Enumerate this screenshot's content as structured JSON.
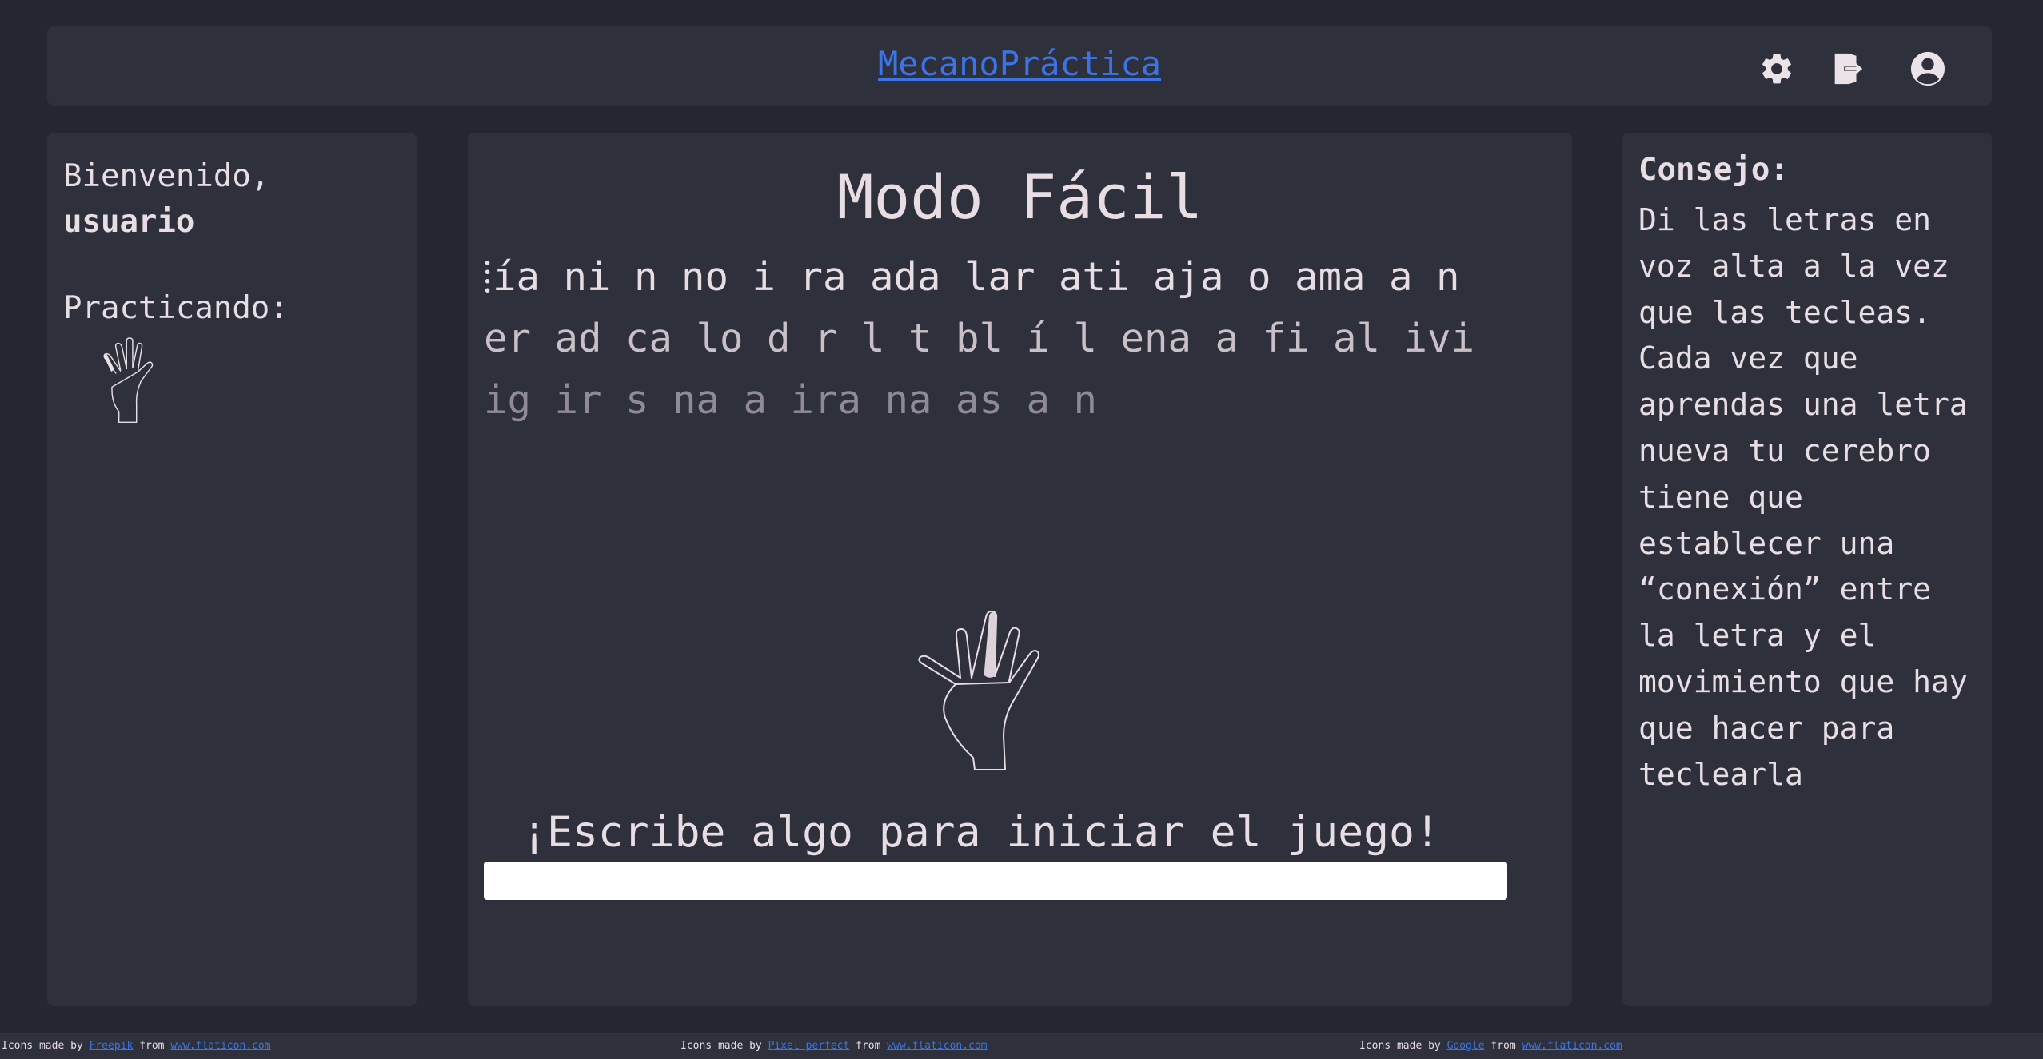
{
  "header": {
    "title": "MecanoPráctica",
    "icons": [
      "gear-icon",
      "logout-icon",
      "user-circle-icon"
    ]
  },
  "sidebar": {
    "greeting": "Bienvenido,",
    "username": "usuario",
    "practicing_label": "Practicando:",
    "practicing_finger": "left-pinky"
  },
  "main": {
    "mode_title": "Modo Fácil",
    "lines": [
      "ía ni n no i ra ada lar ati aja o ama a n",
      "er ad ca lo d r l t bl í l ena a fi al ivi",
      "ig ir s na a ira na as a n"
    ],
    "active_finger": "left-middle",
    "prompt": "¡Escribe algo para iniciar el juego!",
    "input_value": "",
    "input_placeholder": ""
  },
  "tip": {
    "title": "Consejo:",
    "body": "Di las letras en voz alta a la vez que las tecleas. Cada vez que aprendas una letra nueva tu cerebro tiene que establecer una “conexión” entre la letra y el movimiento que hay que hacer para teclearla"
  },
  "footer": {
    "credits": [
      {
        "prefix": "Icons made by",
        "author": "Freepik",
        "mid": "from",
        "site": "www.flaticon.com"
      },
      {
        "prefix": "Icons made by",
        "author": "Pixel perfect",
        "mid": "from",
        "site": "www.flaticon.com"
      },
      {
        "prefix": "Icons made by",
        "author": "Google",
        "mid": "from",
        "site": "www.flaticon.com"
      }
    ]
  },
  "colors": {
    "background": "#242630",
    "panel": "#2e303b",
    "link": "#3b74e6",
    "text": "#e7dde3",
    "finger_highlight": "#e7dde3"
  }
}
